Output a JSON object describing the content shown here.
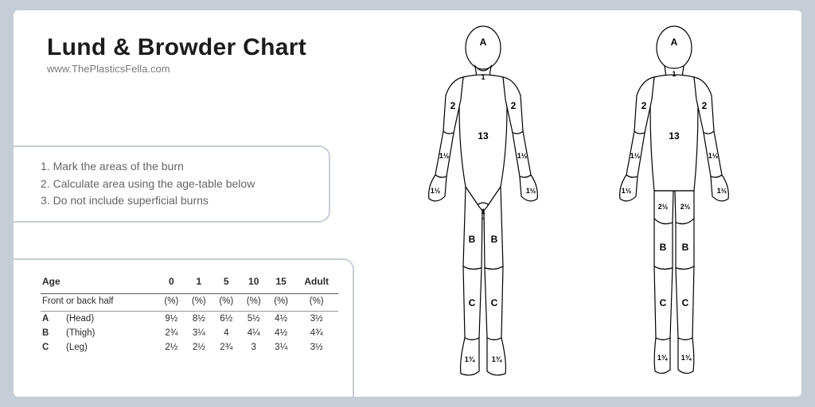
{
  "header": {
    "title": "Lund & Browder Chart",
    "source": "www.ThePlasticsFella.com"
  },
  "instructions": [
    "Mark the areas of the burn",
    "Calculate area using the age-table below",
    "Do not include superficial burns"
  ],
  "table": {
    "age_label": "Age",
    "ages": [
      "0",
      "1",
      "5",
      "10",
      "15",
      "Adult"
    ],
    "unit_label": "Front or back half",
    "unit": "(%)",
    "rows": [
      {
        "letter": "A",
        "name": "(Head)",
        "vals": [
          "9½",
          "8½",
          "6½",
          "5½",
          "4½",
          "3½"
        ]
      },
      {
        "letter": "B",
        "name": "(Thigh)",
        "vals": [
          "2¾",
          "3¼",
          "4",
          "4¼",
          "4½",
          "4¾"
        ]
      },
      {
        "letter": "C",
        "name": "(Leg)",
        "vals": [
          "2½",
          "2½",
          "2¾",
          "3",
          "3¼",
          "3½"
        ]
      }
    ]
  },
  "body_labels": {
    "head": "A",
    "neck": "1",
    "upper_arm": "2",
    "forearm": "1½",
    "hand": "1½",
    "trunk": "13",
    "genital": "1",
    "buttock": "2½",
    "thigh": "B",
    "leg": "C",
    "foot": "1¾"
  }
}
